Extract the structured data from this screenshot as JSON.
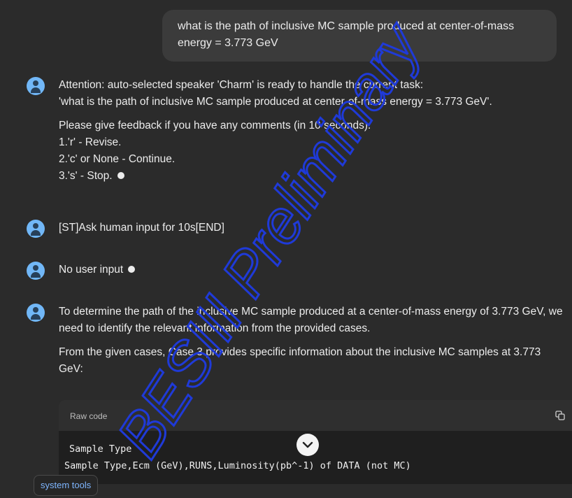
{
  "user_message": {
    "text": "what is the path of inclusive MC sample produced at center-of-mass energy = 3.773 GeV"
  },
  "messages": [
    {
      "paragraphs": [
        "Attention: auto-selected speaker 'Charm' is ready to handle the current task:\n'what is the path of inclusive MC sample produced at center-of-mass energy = 3.773 GeV'.",
        "Please give feedback if you have any comments (in 10 seconds).\n1.'r' - Revise.\n2.'c' or None - Continue.\n3.'s' - Stop."
      ]
    },
    {
      "paragraphs": [
        "[ST]Ask human input for 10s[END]"
      ]
    },
    {
      "paragraphs": [
        "No user input"
      ]
    },
    {
      "paragraphs": [
        "To determine the path of the inclusive MC sample produced at a center-of-mass energy of 3.773 GeV, we need to identify the relevant information from the provided cases.",
        "From the given cases, Case 3 provides specific information about the inclusive MC samples at 3.773 GeV:"
      ]
    }
  ],
  "code_block": {
    "label": "Raw code",
    "line1": "Sample Type",
    "line2": "Sample Type,Ecm (GeV),RUNS,Luminosity(pb^-1) of DATA (not MC)"
  },
  "system_tools": {
    "label": "system tools"
  },
  "watermark": {
    "text": "BESIII Preliminary",
    "color": "#1f3ad8"
  },
  "colors": {
    "background": "#2b2b2b",
    "user_bubble": "#3b3b3b",
    "avatar": "#71b7f7",
    "link": "#7fb6ff"
  },
  "icons": [
    "user-avatar-icon",
    "copy-icon",
    "chevron-down-icon",
    "status-dot-icon"
  ]
}
